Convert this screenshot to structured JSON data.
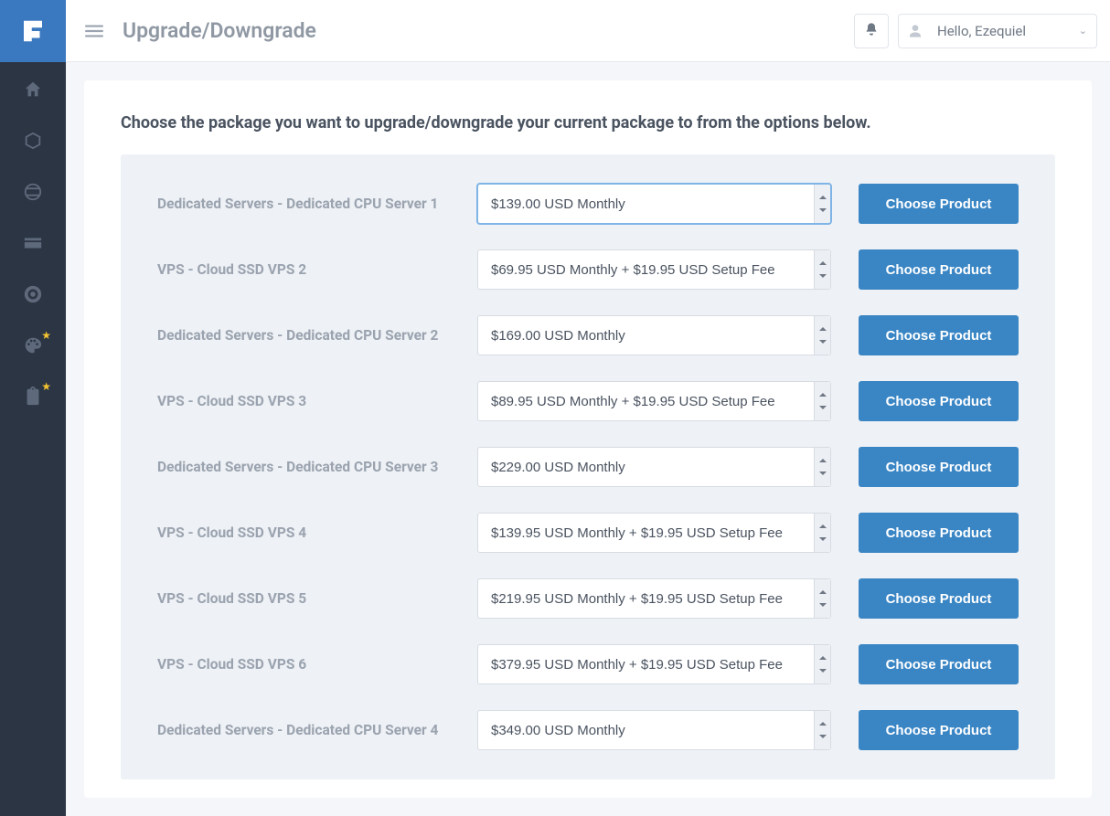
{
  "header": {
    "title": "Upgrade/Downgrade",
    "greeting": "Hello, Ezequiel"
  },
  "sidebar": {
    "items": [
      {
        "name": "home"
      },
      {
        "name": "packages"
      },
      {
        "name": "domains"
      },
      {
        "name": "billing"
      },
      {
        "name": "support"
      },
      {
        "name": "themes",
        "starred": true
      },
      {
        "name": "notes",
        "starred": true
      }
    ]
  },
  "main": {
    "intro": "Choose the package you want to upgrade/downgrade your current package to from the options below.",
    "choose_label": "Choose Product",
    "packages": [
      {
        "label": "Dedicated Servers - Dedicated CPU Server 1",
        "price": "$139.00 USD Monthly",
        "focused": true
      },
      {
        "label": "VPS - Cloud SSD VPS 2",
        "price": "$69.95 USD Monthly + $19.95 USD Setup Fee"
      },
      {
        "label": "Dedicated Servers - Dedicated CPU Server 2",
        "price": "$169.00 USD Monthly"
      },
      {
        "label": "VPS - Cloud SSD VPS 3",
        "price": "$89.95 USD Monthly + $19.95 USD Setup Fee"
      },
      {
        "label": "Dedicated Servers - Dedicated CPU Server 3",
        "price": "$229.00 USD Monthly"
      },
      {
        "label": "VPS - Cloud SSD VPS 4",
        "price": "$139.95 USD Monthly + $19.95 USD Setup Fee"
      },
      {
        "label": "VPS - Cloud SSD VPS 5",
        "price": "$219.95 USD Monthly + $19.95 USD Setup Fee"
      },
      {
        "label": "VPS - Cloud SSD VPS 6",
        "price": "$379.95 USD Monthly + $19.95 USD Setup Fee"
      },
      {
        "label": "Dedicated Servers - Dedicated CPU Server 4",
        "price": "$349.00 USD Monthly"
      }
    ]
  }
}
